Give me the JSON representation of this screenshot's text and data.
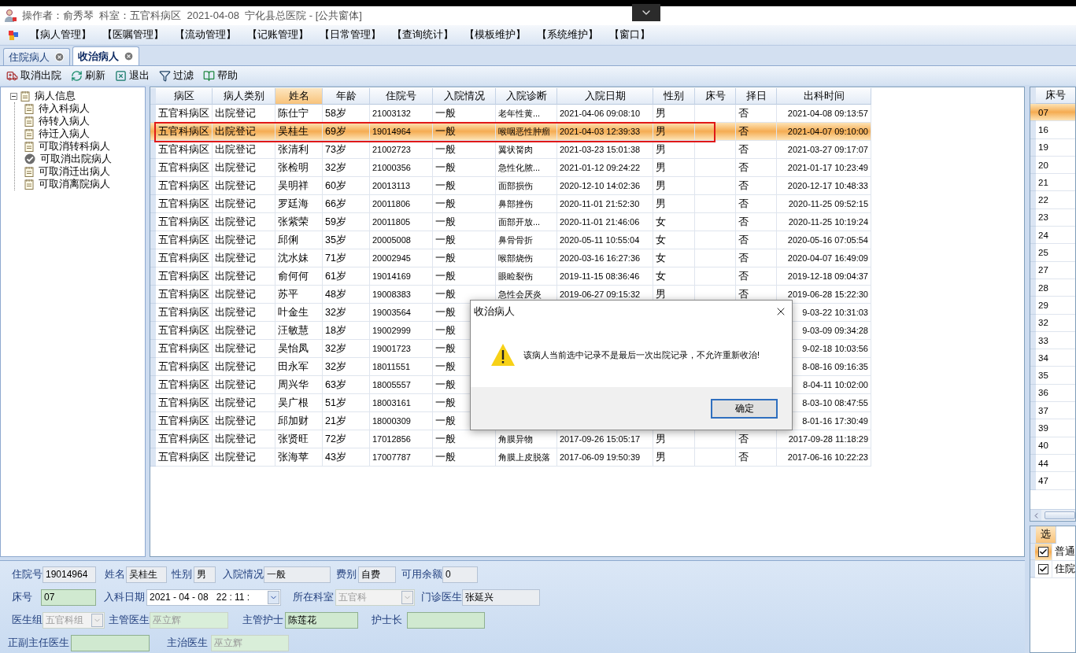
{
  "title_bar": {
    "text": "操作者：俞秀琴  科室：五官科病区  2021-04-08  宁化县总医院 - [公共窗体]"
  },
  "menu": [
    "【病人管理】",
    "【医嘱管理】",
    "【流动管理】",
    "【记账管理】",
    "【日常管理】",
    "【查询统计】",
    "【模板维护】",
    "【系统维护】",
    "【窗口】"
  ],
  "tabs": [
    {
      "label": "住院病人",
      "selected": false
    },
    {
      "label": "收治病人",
      "selected": true
    }
  ],
  "toolbar": [
    "取消出院",
    "刷新",
    "退出",
    "过滤",
    "帮助"
  ],
  "tree": {
    "label": "病人信息",
    "expanded": true,
    "children": [
      {
        "label": "待入科病人",
        "selected": false
      },
      {
        "label": "待转入病人",
        "selected": false
      },
      {
        "label": "待迁入病人",
        "selected": false
      },
      {
        "label": "可取消转科病人",
        "selected": false
      },
      {
        "label": "可取消出院病人",
        "selected": true
      },
      {
        "label": "可取消迁出病人",
        "selected": false
      },
      {
        "label": "可取消离院病人",
        "selected": false
      }
    ]
  },
  "table": {
    "columns": [
      {
        "label": "病区",
        "sorted": false
      },
      {
        "label": "病人类别",
        "sorted": false
      },
      {
        "label": "姓名",
        "sorted": true
      },
      {
        "label": "年龄",
        "sorted": false
      },
      {
        "label": "住院号",
        "sorted": false
      },
      {
        "label": "入院情况",
        "sorted": false
      },
      {
        "label": "入院诊断",
        "sorted": false
      },
      {
        "label": "入院日期",
        "sorted": false
      },
      {
        "label": "性别",
        "sorted": false
      },
      {
        "label": "床号",
        "sorted": false
      },
      {
        "label": "择日",
        "sorted": false
      },
      {
        "label": "出科时间",
        "sorted": false
      }
    ],
    "rows": [
      {
        "selected": false,
        "ward": "五官科病区",
        "type": "出院登记",
        "name": "陈仕宁",
        "age": "58岁",
        "admission_no": "21003132",
        "condition": "一般",
        "diagnosis": "老年性黄...",
        "admit_date": "2021-04-06 09:08:10",
        "sex": "男",
        "choose_day": "否",
        "discharge_time": "2021-04-08 09:13:57"
      },
      {
        "selected": true,
        "ward": "五官科病区",
        "type": "出院登记",
        "name": "吴桂生",
        "age": "69岁",
        "admission_no": "19014964",
        "condition": "一般",
        "diagnosis": "喉咽恶性肿瘤",
        "admit_date": "2021-04-03 12:39:33",
        "sex": "男",
        "choose_day": "否",
        "discharge_time": "2021-04-07 09:10:00"
      },
      {
        "selected": false,
        "ward": "五官科病区",
        "type": "出院登记",
        "name": "张清利",
        "age": "73岁",
        "admission_no": "21002723",
        "condition": "一般",
        "diagnosis": "翼状胬肉",
        "admit_date": "2021-03-23 15:01:38",
        "sex": "男",
        "choose_day": "否",
        "discharge_time": "2021-03-27 09:17:07"
      },
      {
        "selected": false,
        "ward": "五官科病区",
        "type": "出院登记",
        "name": "张检明",
        "age": "32岁",
        "admission_no": "21000356",
        "condition": "一般",
        "diagnosis": "急性化脓...",
        "admit_date": "2021-01-12 09:24:22",
        "sex": "男",
        "choose_day": "否",
        "discharge_time": "2021-01-17 10:23:49"
      },
      {
        "selected": false,
        "ward": "五官科病区",
        "type": "出院登记",
        "name": "吴明祥",
        "age": "60岁",
        "admission_no": "20013113",
        "condition": "一般",
        "diagnosis": "面部损伤",
        "admit_date": "2020-12-10 14:02:36",
        "sex": "男",
        "choose_day": "否",
        "discharge_time": "2020-12-17 10:48:33"
      },
      {
        "selected": false,
        "ward": "五官科病区",
        "type": "出院登记",
        "name": "罗廷海",
        "age": "66岁",
        "admission_no": "20011806",
        "condition": "一般",
        "diagnosis": "鼻部挫伤",
        "admit_date": "2020-11-01 21:52:30",
        "sex": "男",
        "choose_day": "否",
        "discharge_time": "2020-11-25 09:52:15"
      },
      {
        "selected": false,
        "ward": "五官科病区",
        "type": "出院登记",
        "name": "张紫荣",
        "age": "59岁",
        "admission_no": "20011805",
        "condition": "一般",
        "diagnosis": "面部开放...",
        "admit_date": "2020-11-01 21:46:06",
        "sex": "女",
        "choose_day": "否",
        "discharge_time": "2020-11-25 10:19:24"
      },
      {
        "selected": false,
        "ward": "五官科病区",
        "type": "出院登记",
        "name": "邱俐",
        "age": "35岁",
        "admission_no": "20005008",
        "condition": "一般",
        "diagnosis": "鼻骨骨折",
        "admit_date": "2020-05-11 10:55:04",
        "sex": "女",
        "choose_day": "否",
        "discharge_time": "2020-05-16 07:05:54"
      },
      {
        "selected": false,
        "ward": "五官科病区",
        "type": "出院登记",
        "name": "沈水妹",
        "age": "71岁",
        "admission_no": "20002945",
        "condition": "一般",
        "diagnosis": "喉部烧伤",
        "admit_date": "2020-03-16 16:27:36",
        "sex": "女",
        "choose_day": "否",
        "discharge_time": "2020-04-07 16:49:09"
      },
      {
        "selected": false,
        "ward": "五官科病区",
        "type": "出院登记",
        "name": "俞何何",
        "age": "61岁",
        "admission_no": "19014169",
        "condition": "一般",
        "diagnosis": "眼睑裂伤",
        "admit_date": "2019-11-15 08:36:46",
        "sex": "女",
        "choose_day": "否",
        "discharge_time": "2019-12-18 09:04:37"
      },
      {
        "selected": false,
        "ward": "五官科病区",
        "type": "出院登记",
        "name": "苏平",
        "age": "48岁",
        "admission_no": "19008383",
        "condition": "一般",
        "diagnosis": "急性会厌炎",
        "admit_date": "2019-06-27 09:15:32",
        "sex": "男",
        "choose_day": "否",
        "discharge_time": "2019-06-28 15:22:30"
      },
      {
        "selected": false,
        "ward": "五官科病区",
        "type": "出院登记",
        "name": "叶金生",
        "age": "32岁",
        "admission_no": "19003564",
        "condition": "一般",
        "discharge_time": "9-03-22 10:31:03"
      },
      {
        "selected": false,
        "ward": "五官科病区",
        "type": "出院登记",
        "name": "汪敏慧",
        "age": "18岁",
        "admission_no": "19002999",
        "condition": "一般",
        "discharge_time": "9-03-09 09:34:28"
      },
      {
        "selected": false,
        "ward": "五官科病区",
        "type": "出院登记",
        "name": "吴怡凤",
        "age": "32岁",
        "admission_no": "19001723",
        "condition": "一般",
        "discharge_time": "9-02-18 10:03:56"
      },
      {
        "selected": false,
        "ward": "五官科病区",
        "type": "出院登记",
        "name": "田永军",
        "age": "32岁",
        "admission_no": "18011551",
        "condition": "一般",
        "discharge_time": "8-08-16 09:16:35"
      },
      {
        "selected": false,
        "ward": "五官科病区",
        "type": "出院登记",
        "name": "周兴华",
        "age": "63岁",
        "admission_no": "18005557",
        "condition": "一般",
        "discharge_time": "8-04-11 10:02:00"
      },
      {
        "selected": false,
        "ward": "五官科病区",
        "type": "出院登记",
        "name": "吴广根",
        "age": "51岁",
        "admission_no": "18003161",
        "condition": "一般",
        "discharge_time": "8-03-10 08:47:55"
      },
      {
        "selected": false,
        "ward": "五官科病区",
        "type": "出院登记",
        "name": "邱加财",
        "age": "21岁",
        "admission_no": "18000309",
        "condition": "一般",
        "discharge_time": "8-01-16 17:30:49"
      },
      {
        "selected": false,
        "ward": "五官科病区",
        "type": "出院登记",
        "name": "张贤旺",
        "age": "72岁",
        "admission_no": "17012856",
        "condition": "一般",
        "diagnosis": "角膜异物",
        "admit_date": "2017-09-26 15:05:17",
        "sex": "男",
        "choose_day": "否",
        "discharge_time": "2017-09-28 11:18:29"
      },
      {
        "selected": false,
        "ward": "五官科病区",
        "type": "出院登记",
        "name": "张海苹",
        "age": "43岁",
        "admission_no": "17007787",
        "condition": "一般",
        "diagnosis": "角膜上皮脱落",
        "admit_date": "2017-06-09 19:50:39",
        "sex": "男",
        "choose_day": "否",
        "discharge_time": "2017-06-16 10:22:23"
      }
    ]
  },
  "bed_grid": {
    "column": "床号",
    "rows": [
      {
        "bed": "07",
        "selected": true
      },
      {
        "bed": "16",
        "selected": false
      },
      {
        "bed": "19",
        "selected": false
      },
      {
        "bed": "20",
        "selected": false
      },
      {
        "bed": "21",
        "selected": false
      },
      {
        "bed": "22",
        "selected": false
      },
      {
        "bed": "23",
        "selected": false
      },
      {
        "bed": "24",
        "selected": false
      },
      {
        "bed": "25",
        "selected": false
      },
      {
        "bed": "27",
        "selected": false
      },
      {
        "bed": "28",
        "selected": false
      },
      {
        "bed": "29",
        "selected": false
      },
      {
        "bed": "32",
        "selected": false
      },
      {
        "bed": "33",
        "selected": false
      },
      {
        "bed": "34",
        "selected": false
      },
      {
        "bed": "35",
        "selected": false
      },
      {
        "bed": "36",
        "selected": false
      },
      {
        "bed": "37",
        "selected": false
      },
      {
        "bed": "39",
        "selected": false
      },
      {
        "bed": "40",
        "selected": false
      },
      {
        "bed": "44",
        "selected": false
      },
      {
        "bed": "47",
        "selected": false
      }
    ]
  },
  "option_grid": {
    "column": "选",
    "rows": [
      {
        "label": "普通",
        "checked": true,
        "selected": true
      },
      {
        "label": "住院",
        "checked": true,
        "selected": false
      }
    ]
  },
  "form": {
    "fields": [
      {
        "label": "住院号",
        "value": "19014964",
        "kind": "text",
        "disabled": false
      },
      {
        "label": "姓名",
        "value": "吴桂生",
        "kind": "text",
        "disabled": false
      },
      {
        "label": "性别",
        "value": "男",
        "kind": "text",
        "disabled": false
      },
      {
        "label": "入院情况",
        "value": "一般",
        "kind": "text",
        "disabled": false
      },
      {
        "label": "费别",
        "value": "自费",
        "kind": "text",
        "disabled": false
      },
      {
        "label": "可用余额",
        "value": "0",
        "kind": "text",
        "disabled": false
      },
      {
        "label": "床号",
        "value": "07",
        "kind": "editable",
        "disabled": false
      },
      {
        "label": "入科日期",
        "value": "2021 - 04 - 08   22 : 11 :",
        "kind": "date",
        "disabled": false
      },
      {
        "label": "所在科室",
        "value": "五官科",
        "kind": "select",
        "disabled": true
      },
      {
        "label": "门诊医生",
        "value": "张延兴",
        "kind": "text",
        "disabled": false
      },
      {
        "label": "医生组",
        "value": "五官科组",
        "kind": "select",
        "disabled": true
      },
      {
        "label": "主管医生",
        "value": "巫立辉",
        "kind": "editable",
        "disabled": true
      },
      {
        "label": "主管护士",
        "value": "陈莲花",
        "kind": "editable",
        "disabled": false
      },
      {
        "label": "护士长",
        "kind": "editable",
        "disabled": false
      },
      {
        "label": "正副主任医生",
        "kind": "editable",
        "disabled": false
      },
      {
        "label": "主治医生",
        "value": "巫立辉",
        "kind": "editable",
        "disabled": true
      }
    ]
  },
  "dialog": {
    "title": "收治病人",
    "message": "该病人当前选中记录不是最后一次出院记录，不允许重新收治!",
    "button": "确定"
  }
}
